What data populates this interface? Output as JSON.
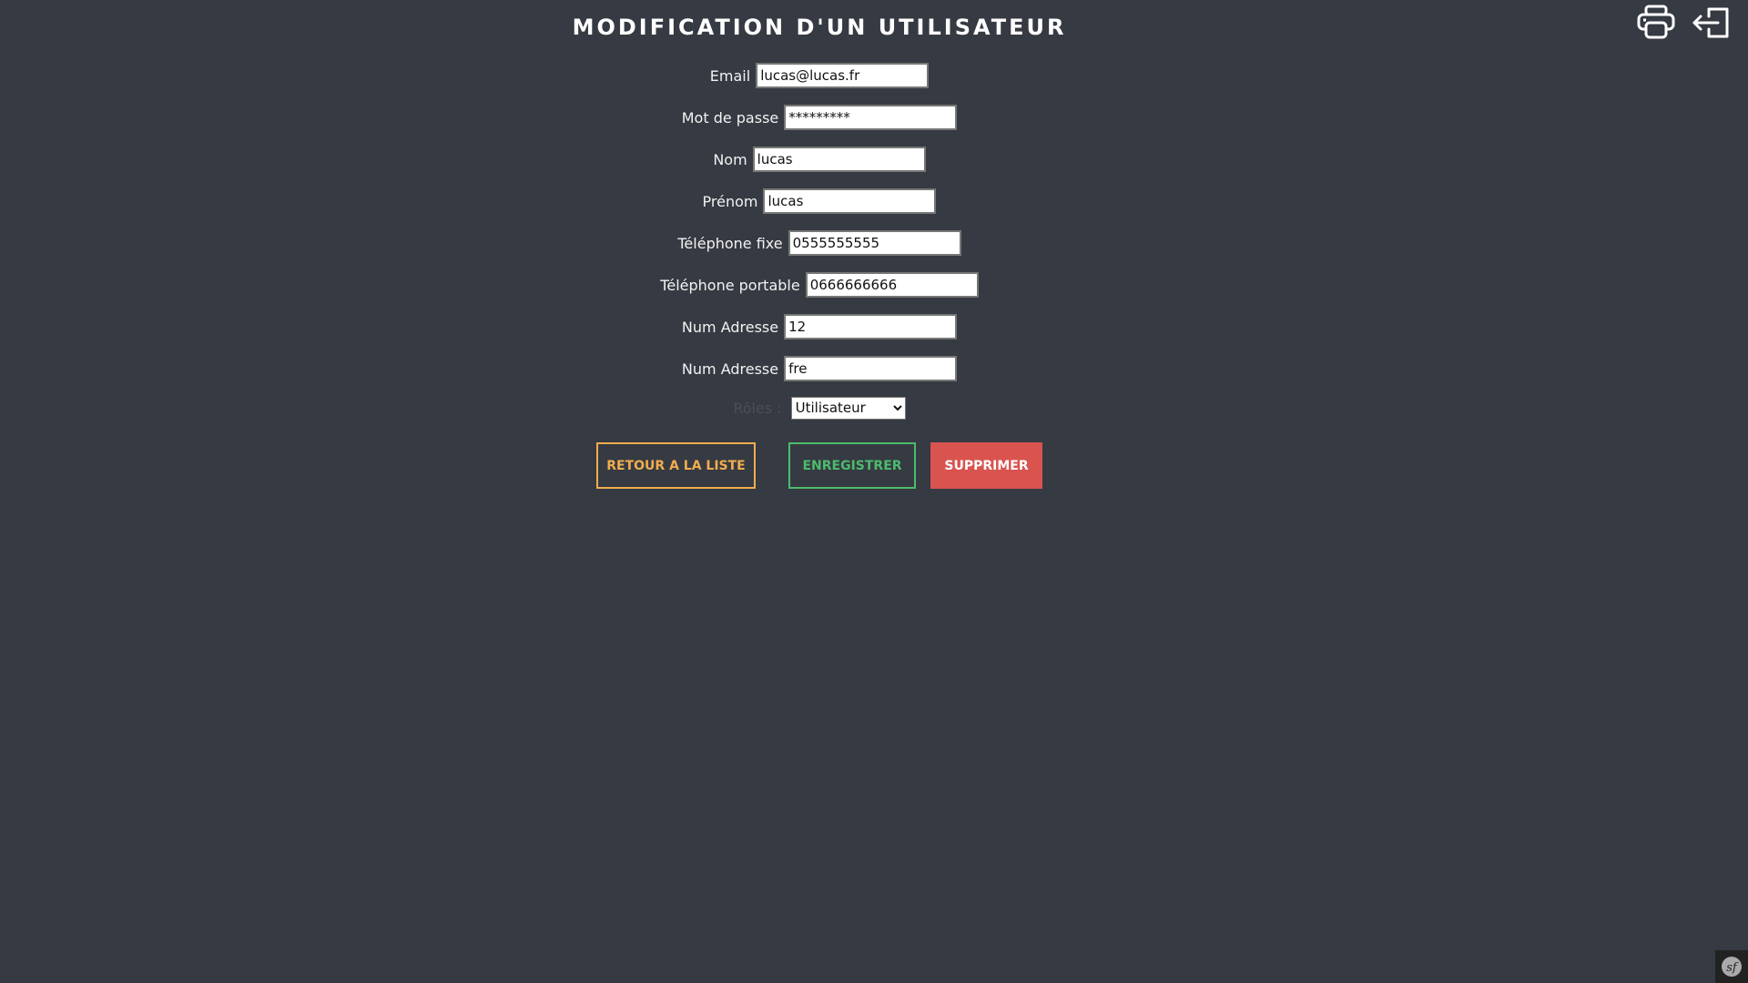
{
  "title": "MODIFICATION D'UN UTILISATEUR",
  "fields": [
    {
      "label": "Email",
      "value": "lucas@lucas.fr",
      "type": "text"
    },
    {
      "label": "Mot de passe",
      "value": "*********",
      "type": "text"
    },
    {
      "label": "Nom",
      "value": "lucas",
      "type": "text"
    },
    {
      "label": "Prénom",
      "value": "lucas",
      "type": "text"
    },
    {
      "label": "Téléphone fixe",
      "value": "0555555555",
      "type": "text"
    },
    {
      "label": "Téléphone portable",
      "value": "0666666666",
      "type": "text"
    },
    {
      "label": "Num Adresse",
      "value": "12",
      "type": "text"
    },
    {
      "label": "Num Adresse",
      "value": "fre",
      "type": "text"
    }
  ],
  "roles": {
    "label": "Rôles :",
    "selected": "Utilisateur"
  },
  "buttons": {
    "back": "RETOUR A LA LISTE",
    "save": "ENREGISTRER",
    "delete": "SUPPRIMER"
  },
  "colors": {
    "background": "#363a42",
    "back": "#f0ad4e",
    "save": "#4cbb6c",
    "delete": "#d9534f"
  }
}
